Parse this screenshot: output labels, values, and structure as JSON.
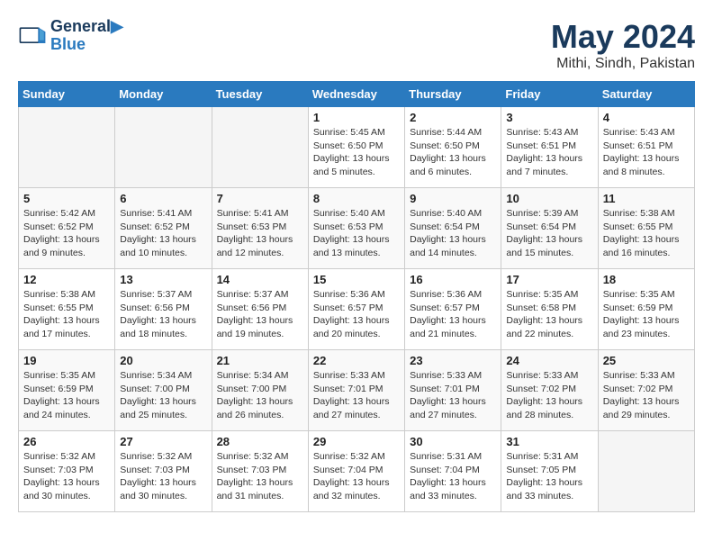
{
  "header": {
    "logo_line1": "General",
    "logo_line2": "Blue",
    "month": "May 2024",
    "location": "Mithi, Sindh, Pakistan"
  },
  "days_of_week": [
    "Sunday",
    "Monday",
    "Tuesday",
    "Wednesday",
    "Thursday",
    "Friday",
    "Saturday"
  ],
  "weeks": [
    [
      {
        "day": "",
        "info": ""
      },
      {
        "day": "",
        "info": ""
      },
      {
        "day": "",
        "info": ""
      },
      {
        "day": "1",
        "info": "Sunrise: 5:45 AM\nSunset: 6:50 PM\nDaylight: 13 hours\nand 5 minutes."
      },
      {
        "day": "2",
        "info": "Sunrise: 5:44 AM\nSunset: 6:50 PM\nDaylight: 13 hours\nand 6 minutes."
      },
      {
        "day": "3",
        "info": "Sunrise: 5:43 AM\nSunset: 6:51 PM\nDaylight: 13 hours\nand 7 minutes."
      },
      {
        "day": "4",
        "info": "Sunrise: 5:43 AM\nSunset: 6:51 PM\nDaylight: 13 hours\nand 8 minutes."
      }
    ],
    [
      {
        "day": "5",
        "info": "Sunrise: 5:42 AM\nSunset: 6:52 PM\nDaylight: 13 hours\nand 9 minutes."
      },
      {
        "day": "6",
        "info": "Sunrise: 5:41 AM\nSunset: 6:52 PM\nDaylight: 13 hours\nand 10 minutes."
      },
      {
        "day": "7",
        "info": "Sunrise: 5:41 AM\nSunset: 6:53 PM\nDaylight: 13 hours\nand 12 minutes."
      },
      {
        "day": "8",
        "info": "Sunrise: 5:40 AM\nSunset: 6:53 PM\nDaylight: 13 hours\nand 13 minutes."
      },
      {
        "day": "9",
        "info": "Sunrise: 5:40 AM\nSunset: 6:54 PM\nDaylight: 13 hours\nand 14 minutes."
      },
      {
        "day": "10",
        "info": "Sunrise: 5:39 AM\nSunset: 6:54 PM\nDaylight: 13 hours\nand 15 minutes."
      },
      {
        "day": "11",
        "info": "Sunrise: 5:38 AM\nSunset: 6:55 PM\nDaylight: 13 hours\nand 16 minutes."
      }
    ],
    [
      {
        "day": "12",
        "info": "Sunrise: 5:38 AM\nSunset: 6:55 PM\nDaylight: 13 hours\nand 17 minutes."
      },
      {
        "day": "13",
        "info": "Sunrise: 5:37 AM\nSunset: 6:56 PM\nDaylight: 13 hours\nand 18 minutes."
      },
      {
        "day": "14",
        "info": "Sunrise: 5:37 AM\nSunset: 6:56 PM\nDaylight: 13 hours\nand 19 minutes."
      },
      {
        "day": "15",
        "info": "Sunrise: 5:36 AM\nSunset: 6:57 PM\nDaylight: 13 hours\nand 20 minutes."
      },
      {
        "day": "16",
        "info": "Sunrise: 5:36 AM\nSunset: 6:57 PM\nDaylight: 13 hours\nand 21 minutes."
      },
      {
        "day": "17",
        "info": "Sunrise: 5:35 AM\nSunset: 6:58 PM\nDaylight: 13 hours\nand 22 minutes."
      },
      {
        "day": "18",
        "info": "Sunrise: 5:35 AM\nSunset: 6:59 PM\nDaylight: 13 hours\nand 23 minutes."
      }
    ],
    [
      {
        "day": "19",
        "info": "Sunrise: 5:35 AM\nSunset: 6:59 PM\nDaylight: 13 hours\nand 24 minutes."
      },
      {
        "day": "20",
        "info": "Sunrise: 5:34 AM\nSunset: 7:00 PM\nDaylight: 13 hours\nand 25 minutes."
      },
      {
        "day": "21",
        "info": "Sunrise: 5:34 AM\nSunset: 7:00 PM\nDaylight: 13 hours\nand 26 minutes."
      },
      {
        "day": "22",
        "info": "Sunrise: 5:33 AM\nSunset: 7:01 PM\nDaylight: 13 hours\nand 27 minutes."
      },
      {
        "day": "23",
        "info": "Sunrise: 5:33 AM\nSunset: 7:01 PM\nDaylight: 13 hours\nand 27 minutes."
      },
      {
        "day": "24",
        "info": "Sunrise: 5:33 AM\nSunset: 7:02 PM\nDaylight: 13 hours\nand 28 minutes."
      },
      {
        "day": "25",
        "info": "Sunrise: 5:33 AM\nSunset: 7:02 PM\nDaylight: 13 hours\nand 29 minutes."
      }
    ],
    [
      {
        "day": "26",
        "info": "Sunrise: 5:32 AM\nSunset: 7:03 PM\nDaylight: 13 hours\nand 30 minutes."
      },
      {
        "day": "27",
        "info": "Sunrise: 5:32 AM\nSunset: 7:03 PM\nDaylight: 13 hours\nand 30 minutes."
      },
      {
        "day": "28",
        "info": "Sunrise: 5:32 AM\nSunset: 7:03 PM\nDaylight: 13 hours\nand 31 minutes."
      },
      {
        "day": "29",
        "info": "Sunrise: 5:32 AM\nSunset: 7:04 PM\nDaylight: 13 hours\nand 32 minutes."
      },
      {
        "day": "30",
        "info": "Sunrise: 5:31 AM\nSunset: 7:04 PM\nDaylight: 13 hours\nand 33 minutes."
      },
      {
        "day": "31",
        "info": "Sunrise: 5:31 AM\nSunset: 7:05 PM\nDaylight: 13 hours\nand 33 minutes."
      },
      {
        "day": "",
        "info": ""
      }
    ]
  ]
}
